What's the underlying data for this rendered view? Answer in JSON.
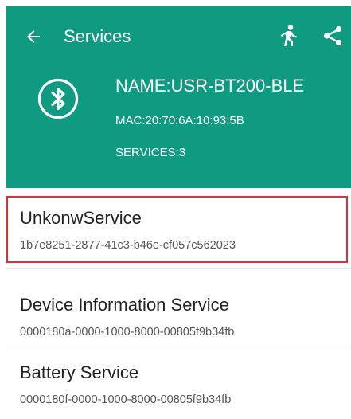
{
  "toolbar": {
    "title": "Services",
    "back_icon": "arrow-back-icon",
    "run_icon": "running-figure-icon",
    "share_icon": "share-icon"
  },
  "device": {
    "icon": "bluetooth-icon",
    "name": "NAME:USR-BT200-BLE",
    "mac": "MAC:20:70:6A:10:93:5B",
    "services": "SERVICES:3"
  },
  "services": [
    {
      "name": "UnkonwService",
      "uuid": "1b7e8251-2877-41c3-b46e-cf057c562023",
      "highlighted": true
    },
    {
      "name": "Device Information Service",
      "uuid": "0000180a-0000-1000-8000-00805f9b34fb"
    },
    {
      "name": "Battery Service",
      "uuid": "0000180f-0000-1000-8000-00805f9b34fb"
    }
  ],
  "colors": {
    "header": "#0f9a82",
    "highlight_border": "#d9313b"
  }
}
